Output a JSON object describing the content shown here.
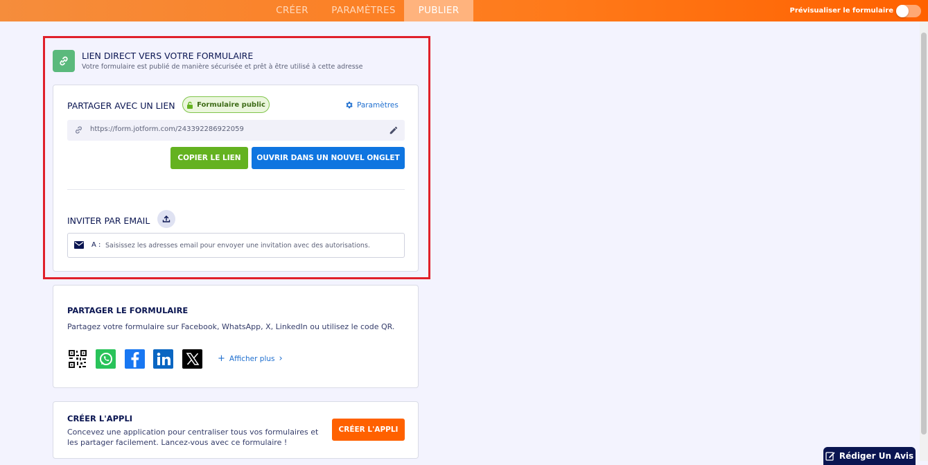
{
  "nav": {
    "tabs": [
      {
        "label": "CRÉER",
        "active": false
      },
      {
        "label": "PARAMÈTRES",
        "active": false
      },
      {
        "label": "PUBLIER",
        "active": true
      }
    ],
    "preview_label": "Prévisualiser le formulaire",
    "preview_enabled": false
  },
  "direct_link": {
    "title": "LIEN DIRECT VERS VOTRE FORMULAIRE",
    "subtitle": "Votre formulaire est publié de manière sécurisée et prêt à être utilisé à cette adresse",
    "share_title": "PARTAGER AVEC UN LIEN",
    "badge": "Formulaire public",
    "settings_label": "Paramètres",
    "url": "https://form.jotform.com/243392286922059",
    "copy_label": "COPIER LE LIEN",
    "open_label": "OUVRIR DANS UN NOUVEL ONGLET",
    "invite_title": "INVITER PAR EMAIL",
    "email_to_label": "A :",
    "email_placeholder": "Saisissez les adresses email pour envoyer une invitation avec des autorisations."
  },
  "share_form": {
    "title": "PARTAGER LE FORMULAIRE",
    "description": "Partagez votre formulaire sur Facebook, WhatsApp, X, LinkedIn ou utilisez le code QR.",
    "networks": [
      "qr-code",
      "whatsapp",
      "facebook",
      "linkedin",
      "x"
    ],
    "more_label": "Afficher plus"
  },
  "create_app": {
    "title": "CRÉER L'APPLI",
    "description": "Concevez une application pour centraliser tous vos formulaires et les partager facilement. Lancez-vous avec ce formulaire !",
    "button_label": "CRÉER L'APPLI"
  },
  "feedback": {
    "label": "Rédiger Un Avis"
  },
  "colors": {
    "brand_orange": "#ff6100",
    "copy_green": "#64b220",
    "open_blue": "#0f75e0",
    "highlight_red": "#e0202a",
    "navy": "#0a1551"
  },
  "icons": {
    "link_card": "link-icon",
    "settings": "gear-icon",
    "url": "chain-icon",
    "edit": "pencil-icon",
    "invite": "upload-icon",
    "email": "envelope-icon",
    "feedback": "edit-note-icon"
  }
}
